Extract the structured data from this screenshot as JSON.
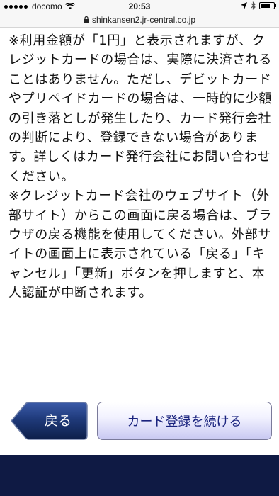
{
  "status_bar": {
    "carrier": "docomo",
    "time": "20:53"
  },
  "browser": {
    "url": "shinkansen2.jr-central.co.jp"
  },
  "content": {
    "paragraphs": [
      "※利用金額が「1円」と表示されますが、クレジットカードの場合は、実際に決済されることはありません。ただし、デビットカードやプリペイドカードの場合は、一時的に少額の引き落としが発生したり、カード発行会社の判断により、登録できない場合があります。詳しくはカード発行会社にお問い合わせください。",
      "※クレジットカード会社のウェブサイト（外部サイト）からこの画面に戻る場合は、ブラウザの戻る機能を使用してください。外部サイトの画面上に表示されている「戻る」「キャンセル」「更新」ボタンを押しますと、本人認証が中断されます。"
    ]
  },
  "actions": {
    "back_label": "戻る",
    "continue_label": "カード登録を続ける"
  },
  "colors": {
    "back_button": "#1c2f63",
    "continue_text": "#1a237e",
    "footer": "#0f1a44"
  }
}
